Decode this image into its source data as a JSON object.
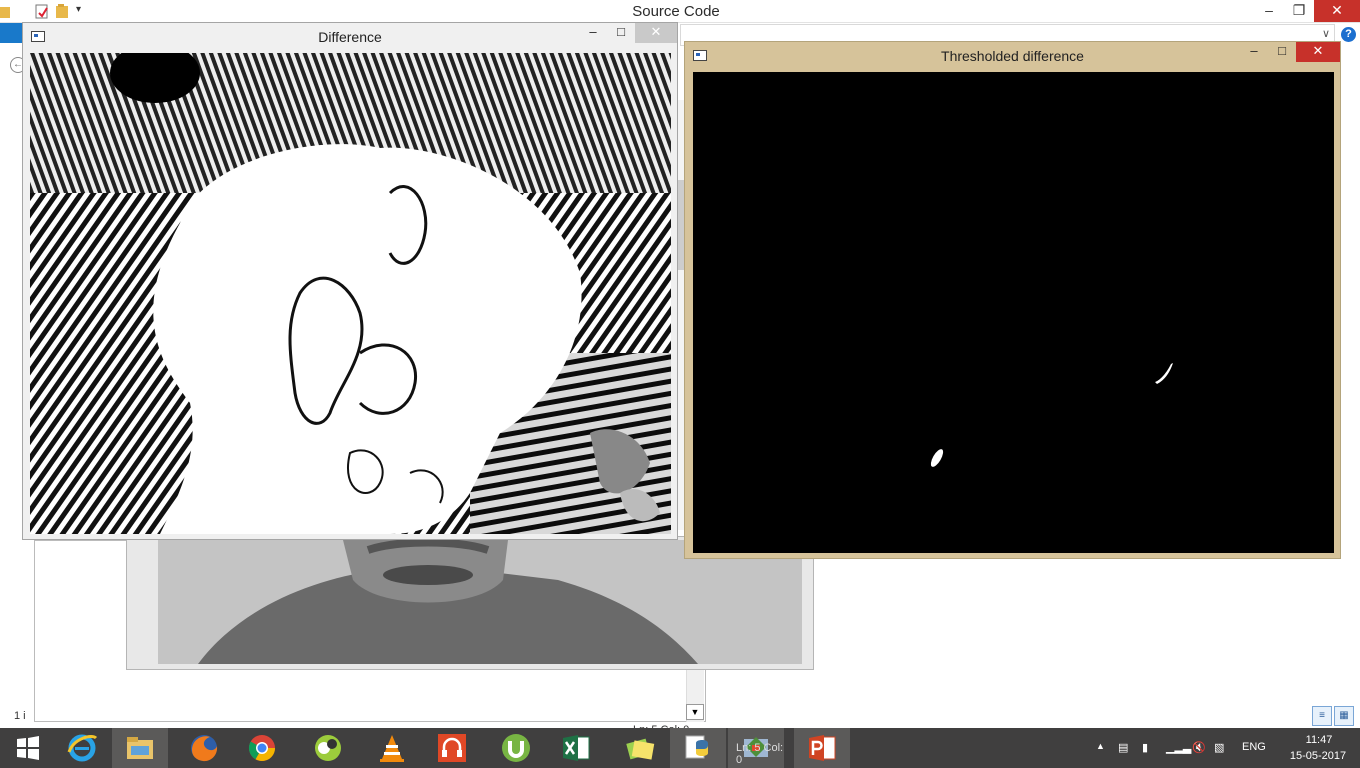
{
  "explorer": {
    "title": "Source Code",
    "controls": {
      "minimize": "–",
      "restore": "❐",
      "close": "✕"
    },
    "address_chevron": "∨",
    "help": "?",
    "back": "←",
    "status_items": "1 i",
    "editor_status": "Ln: 5   Col: 0"
  },
  "difference_window": {
    "title": "Difference",
    "controls": {
      "minimize": "–",
      "maximize": "□",
      "close": "✕"
    }
  },
  "threshold_window": {
    "title": "Thresholded difference",
    "controls": {
      "minimize": "–",
      "maximize": "□",
      "close": "✕"
    }
  },
  "taskbar": {
    "apps": [
      {
        "name": "start-button",
        "icon": "windows-logo-icon"
      },
      {
        "name": "internet-explorer",
        "icon": "ie-icon"
      },
      {
        "name": "file-explorer",
        "icon": "folder-icon"
      },
      {
        "name": "firefox",
        "icon": "firefox-icon"
      },
      {
        "name": "chrome",
        "icon": "chrome-icon"
      },
      {
        "name": "media-app",
        "icon": "media-icon"
      },
      {
        "name": "vlc",
        "icon": "vlc-cone-icon"
      },
      {
        "name": "audio-app",
        "icon": "headphones-icon"
      },
      {
        "name": "utorrent",
        "icon": "utorrent-icon"
      },
      {
        "name": "excel",
        "icon": "excel-icon"
      },
      {
        "name": "notes-app",
        "icon": "sticky-notes-icon"
      },
      {
        "name": "python-idle",
        "icon": "python-icon"
      },
      {
        "name": "python-shell",
        "icon": "python-shell-icon"
      },
      {
        "name": "powerpoint",
        "icon": "powerpoint-icon"
      }
    ],
    "idle_overlay_text": "Ln: 5  Col: 0",
    "tray": {
      "language": "ENG",
      "time": "11:47",
      "date": "15-05-2017"
    }
  },
  "colors": {
    "taskbar": "#403f3f",
    "threshold_frame": "#d6c39a",
    "close_red": "#c7312a"
  }
}
